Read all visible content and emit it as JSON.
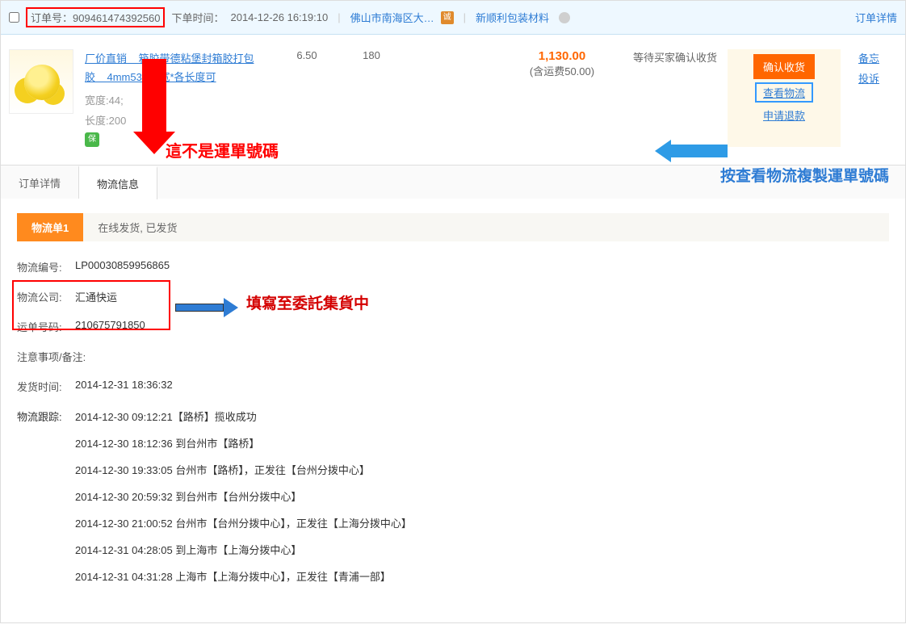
{
  "header": {
    "order_label": "订单号：",
    "order_id": "909461474392560",
    "order_time_label": "下单时间：",
    "order_time": "2014-12-26 16:19:10",
    "region": "佛山市南海区大…",
    "badge": "诚",
    "seller": "新顺利包装材料",
    "details_link": "订单详情"
  },
  "product": {
    "title_pre": "厂价直销",
    "title_mid": "箱胶带德粘堡封箱胶打包胶",
    "title_suf": "4mm53mm宽*各长度可",
    "width_label": "宽度:",
    "width_value": "44;",
    "length_label": "长度:",
    "length_value": "200",
    "bao": "保",
    "price": "6.50",
    "qty": "180",
    "total": "1,130.00",
    "ship_fee": "(含运费50.00)",
    "status": "等待买家确认收货",
    "btn_confirm": "确认收货",
    "link_logistics": "查看物流",
    "link_refund": "申请退款",
    "op_memo": "备忘",
    "op_complain": "投诉"
  },
  "annotations": {
    "not_waybill": "這不是運單號碼",
    "click_view": "按查看物流複製運單號碼",
    "fill_form": "填寫至委託集貨中"
  },
  "tabs": {
    "details": "订单详情",
    "logistics": "物流信息"
  },
  "logistics": {
    "tab_label": "物流单1",
    "tab_status": "在线发货, 已发货",
    "num_label": "物流编号:",
    "num_value": "LP00030859956865",
    "company_label": "物流公司:",
    "company_value": "汇通快运",
    "waybill_label": "运单号码:",
    "waybill_value": "210675791850",
    "notes_label": "注意事项/备注:",
    "ship_time_label": "发货时间:",
    "ship_time_value": "2014-12-31 18:36:32",
    "track_label": "物流跟踪:",
    "tracks": [
      "2014-12-30 09:12:21【路桥】揽收成功",
      "2014-12-30 18:12:36 到台州市【路桥】",
      "2014-12-30 19:33:05 台州市【路桥】，正发往【台州分拨中心】",
      "2014-12-30 20:59:32 到台州市【台州分拨中心】",
      "2014-12-30 21:00:52 台州市【台州分拨中心】，正发往【上海分拨中心】",
      "2014-12-31 04:28:05 到上海市【上海分拨中心】",
      "2014-12-31 04:31:28 上海市【上海分拨中心】，正发往【青浦一部】"
    ]
  }
}
